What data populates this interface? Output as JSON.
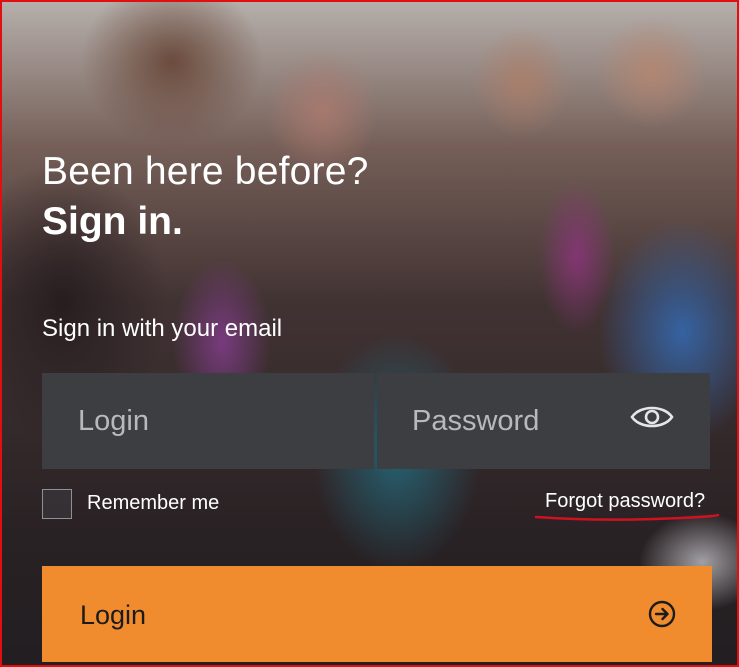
{
  "heading": {
    "line1": "Been here before?",
    "line2": "Sign in."
  },
  "subtitle": "Sign in with your email",
  "form": {
    "login_placeholder": "Login",
    "password_placeholder": "Password",
    "show_password_icon": "eye-icon",
    "remember_label": "Remember me",
    "remember_checked": false,
    "forgot_label": "Forgot password?",
    "submit_label": "Login",
    "submit_icon": "arrow-right-circle-icon"
  },
  "colors": {
    "accent": "#f08c2e",
    "field_bg": "#3d3e42",
    "annotation": "#e01010"
  }
}
